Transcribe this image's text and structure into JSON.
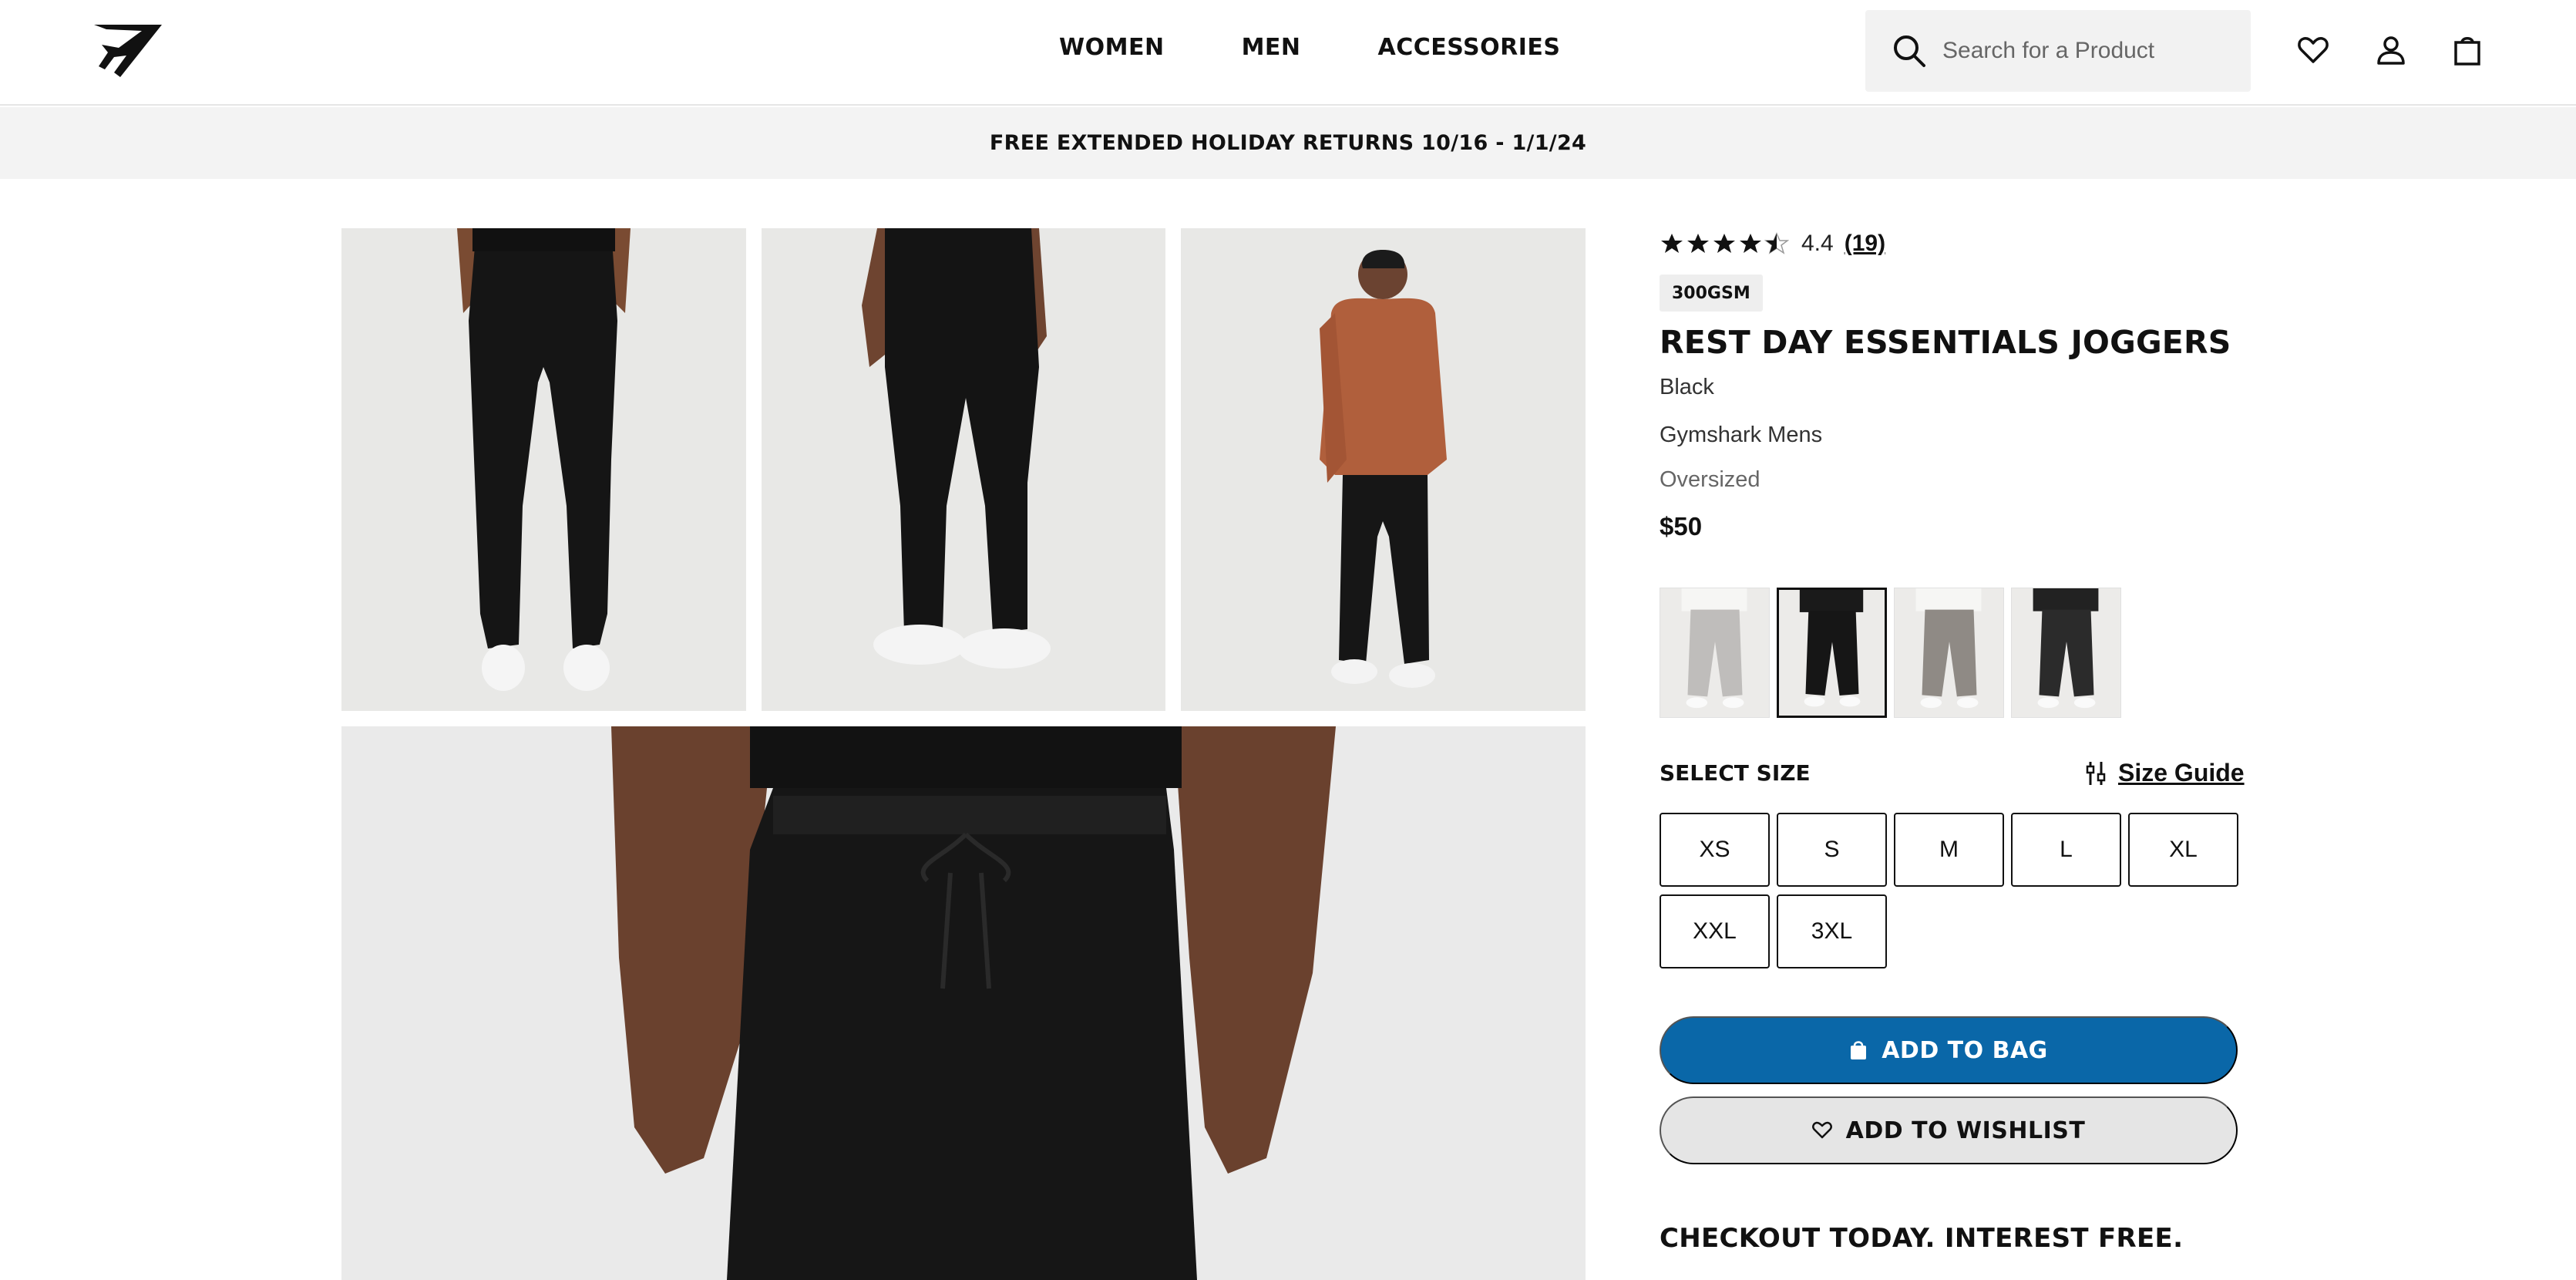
{
  "header": {
    "logo_icon": "gymshark-logo-icon",
    "nav": [
      {
        "label": "WOMEN"
      },
      {
        "label": "MEN"
      },
      {
        "label": "ACCESSORIES"
      }
    ],
    "search": {
      "placeholder": "Search for a Product",
      "icon": "search-icon"
    },
    "icons": [
      "heart-icon",
      "user-icon",
      "bag-icon"
    ]
  },
  "promo": {
    "text": "FREE EXTENDED HOLIDAY RETURNS 10/16 - 1/1/24"
  },
  "gallery": {
    "images": [
      {
        "name": "back-view"
      },
      {
        "name": "side-view"
      },
      {
        "name": "full-body-with-hoodie"
      },
      {
        "name": "waist-closeup"
      }
    ]
  },
  "product": {
    "rating": {
      "value": "4.4",
      "count": "(19)",
      "stars": 4.4,
      "max": 5
    },
    "badge": "300GSM",
    "title": "REST DAY ESSENTIALS JOGGERS",
    "color": "Black",
    "brand": "Gymshark Mens",
    "fit": "Oversized",
    "price": "$50",
    "swatches": [
      {
        "name": "light-grey",
        "color": "#bfbdbb",
        "selected": false
      },
      {
        "name": "black",
        "color": "#161616",
        "selected": true
      },
      {
        "name": "taupe",
        "color": "#8f8a85",
        "selected": false
      },
      {
        "name": "charcoal",
        "color": "#2b2b2b",
        "selected": false
      }
    ],
    "size_label": "SELECT SIZE",
    "size_guide_label": "Size Guide",
    "sizes": [
      "XS",
      "S",
      "M",
      "L",
      "XL",
      "XXL",
      "3XL"
    ],
    "add_to_bag": "ADD TO BAG",
    "add_to_wishlist": "ADD TO WISHLIST",
    "checkout_heading": "CHECKOUT TODAY. INTEREST FREE."
  },
  "colors": {
    "accent": "#0a67a8",
    "promo_bg": "#f3f3f3",
    "secondary_btn": "#e5e5e5"
  }
}
